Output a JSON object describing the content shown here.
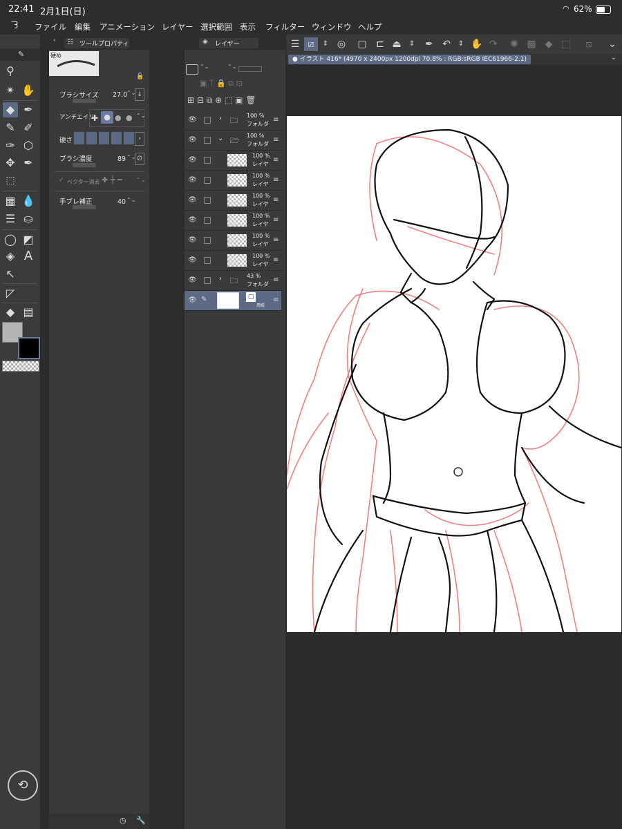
{
  "status": {
    "time": "22:41",
    "date": "2月1日(日)",
    "battery": "62%"
  },
  "menu": [
    "ファイル",
    "編集",
    "アニメーション",
    "レイヤー",
    "選択範囲",
    "表示",
    "フィルター",
    "ウィンドウ",
    "ヘルプ"
  ],
  "document_tab": "イラスト 416* (4970 x 2400px 1200dpi 70.8% : RGB:sRGB IEC61966-2.1)",
  "tool_property": {
    "title": "ツールプロパティ",
    "brush_name": "硬め",
    "brush_size_label": "ブラシサイズ",
    "brush_size_value": "27.0",
    "antialias_label": "アンチエイリ",
    "hardness_label": "硬さ",
    "density_label": "ブラシ濃度",
    "density_value": "89",
    "vector_erase_label": "ベクター消去",
    "stabilization_label": "手ブレ補正",
    "stabilization_value": "40"
  },
  "layers": {
    "title": "レイヤー",
    "items": [
      {
        "pct": "100 %",
        "name": "フォルダ"
      },
      {
        "pct": "100 %",
        "name": "フォルダ"
      },
      {
        "pct": "100 %",
        "name": "レイヤ"
      },
      {
        "pct": "100 %",
        "name": "レイヤ"
      },
      {
        "pct": "100 %",
        "name": "レイヤ"
      },
      {
        "pct": "100 %",
        "name": "レイヤ"
      },
      {
        "pct": "100 %",
        "name": "レイヤ"
      },
      {
        "pct": "100 %",
        "name": "レイヤ"
      },
      {
        "pct": "43 %",
        "name": "フォルダ"
      },
      {
        "pct": "",
        "name": "用紙"
      }
    ]
  },
  "colors": {
    "main_color": "#b4b4b4",
    "sub_color": "#000000",
    "accent": "#5d6a86",
    "sketch_red": "#f08080"
  }
}
